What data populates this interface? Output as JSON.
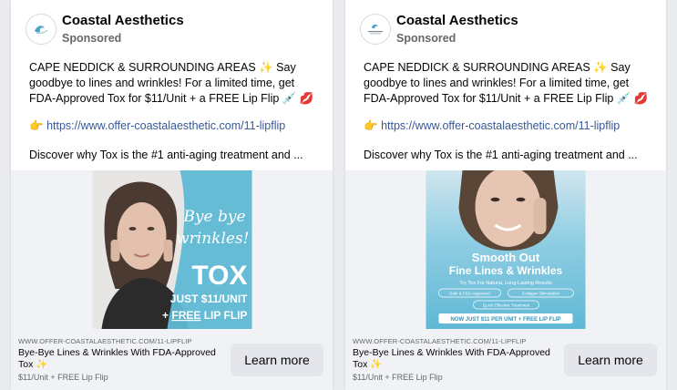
{
  "ads": [
    {
      "brand": "Coastal Aesthetics",
      "sponsored": "Sponsored",
      "body_line1": "CAPE NEDDICK & SURROUNDING AREAS ✨ Say goodbye to lines and wrinkles! For a limited time, get FDA-Approved Tox for $11/Unit + a FREE Lip Flip 💉 💋",
      "link_emoji": "👉",
      "link": "https://www.offer-coastalaesthetic.com/11-lipflip",
      "discover": "Discover why Tox is the #1 anti-aging treatment and ...",
      "creative": {
        "line1": "Bye bye",
        "line2": "wrinkles!",
        "big": "TOX",
        "price": "JUST $11/UNIT",
        "plus": "+ ",
        "free": "FREE",
        "lip": " LIP FLIP"
      },
      "footer": {
        "domain": "WWW.OFFER-COASTALAESTHETIC.COM/11-LIPFLIP",
        "title": "Bye-Bye Lines & Wrinkles With FDA-Approved Tox ✨",
        "desc": "$11/Unit + FREE Lip Flip",
        "cta": "Learn more"
      }
    },
    {
      "brand": "Coastal Aesthetics",
      "sponsored": "Sponsored",
      "body_line1": "CAPE NEDDICK & SURROUNDING AREAS ✨ Say goodbye to lines and wrinkles! For a limited time, get FDA-Approved Tox for $11/Unit + a FREE Lip Flip 💉 💋",
      "link_emoji": "👉",
      "link": "https://www.offer-coastalaesthetic.com/11-lipflip",
      "discover": "Discover why Tox is the #1 anti-aging treatment and ...",
      "creative": {
        "headline1": "Smooth Out",
        "headline2": "Fine Lines & Wrinkles",
        "sub": "Try Tox For Natural, Long-Lasting Results",
        "pill1": "Safe & FDA-Approved",
        "pill2": "Collagen Stimulation",
        "pill3": "Quick Effective Treatment",
        "bar": "NOW JUST $11 PER UNIT + FREE LIP FLIP"
      },
      "footer": {
        "domain": "WWW.OFFER-COASTALAESTHETIC.COM/11-LIPFLIP",
        "title": "Bye-Bye Lines & Wrinkles With FDA-Approved Tox ✨",
        "desc": "$11/Unit + FREE Lip Flip",
        "cta": "Learn more"
      }
    }
  ],
  "colors": {
    "link": "#385898",
    "creative_teal": "#5fb8d4",
    "creative_teal_light": "#8fd0e4",
    "cta_bg": "#e4e6eb"
  }
}
